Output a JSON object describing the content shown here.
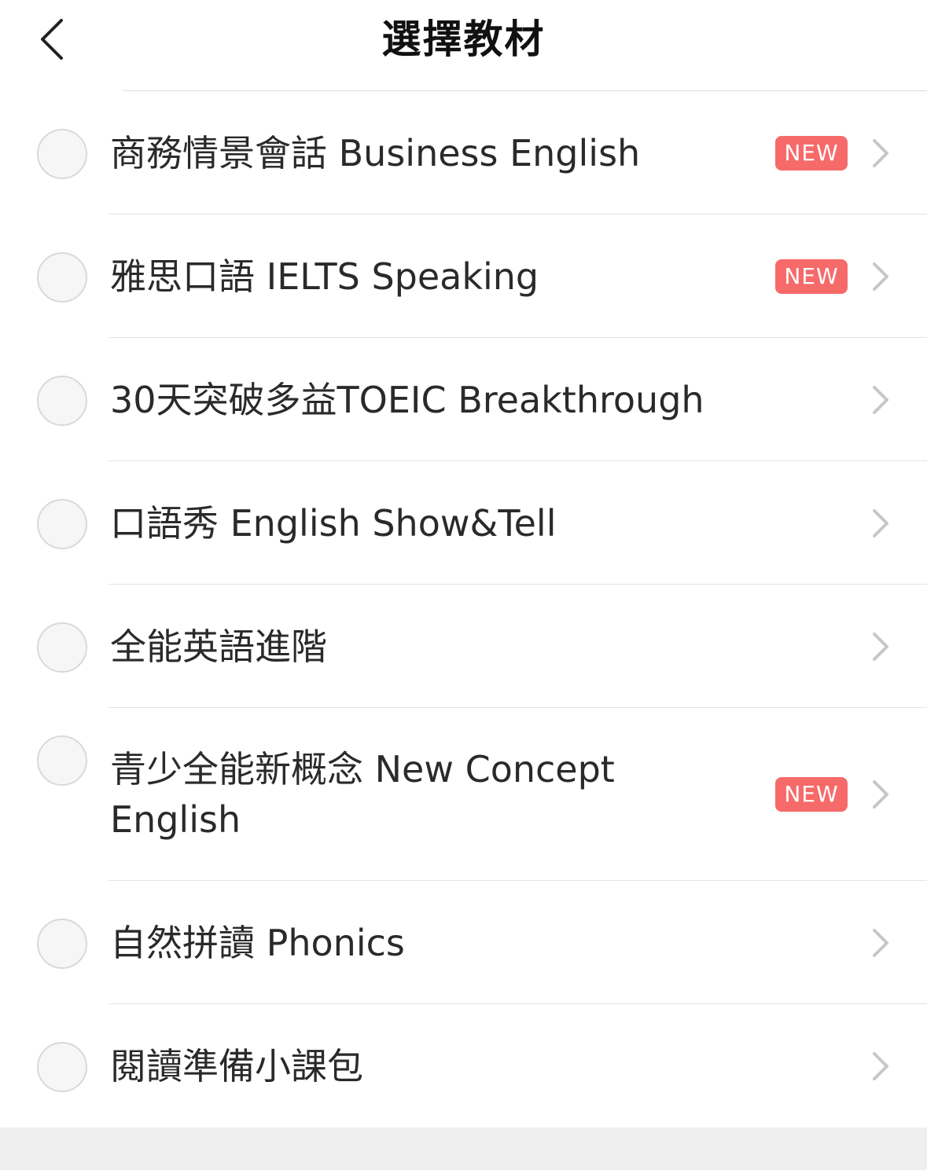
{
  "header": {
    "title": "選擇教材",
    "back_icon": "chevron-left-icon"
  },
  "colors": {
    "badge_bg": "#f66a6a",
    "footer_bg": "#efefef"
  },
  "materials": [
    {
      "label": "商務情景會話 Business English",
      "badge": "NEW"
    },
    {
      "label": "雅思口語 IELTS Speaking",
      "badge": "NEW"
    },
    {
      "label": "30天突破多益TOEIC Breakthrough",
      "badge": ""
    },
    {
      "label": "口語秀 English Show&Tell",
      "badge": ""
    },
    {
      "label": "全能英語進階",
      "badge": ""
    },
    {
      "label": "青少全能新概念 New Concept English",
      "badge": "NEW"
    },
    {
      "label": "自然拼讀 Phonics",
      "badge": ""
    },
    {
      "label": "閱讀準備小課包",
      "badge": ""
    }
  ]
}
